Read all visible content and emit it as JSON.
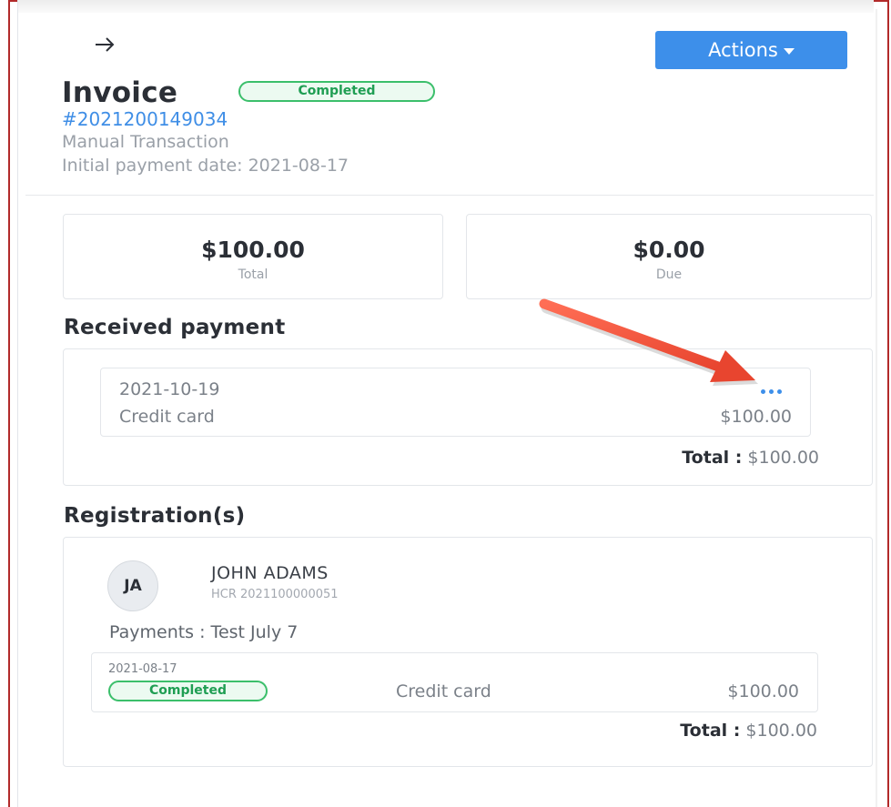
{
  "header": {
    "back_icon": "arrow-right-icon",
    "actions_label": "Actions",
    "title": "Invoice",
    "status_badge": "Completed",
    "invoice_number": "#2021200149034",
    "transaction_type": "Manual Transaction",
    "initial_payment_date": "Initial payment date: 2021-08-17"
  },
  "summary": [
    {
      "amount": "$100.00",
      "label": "Total"
    },
    {
      "amount": "$0.00",
      "label": "Due"
    }
  ],
  "received_payment": {
    "title": "Received payment",
    "items": [
      {
        "date": "2021-10-19",
        "method": "Credit card",
        "amount": "$100.00",
        "menu_icon": "more-horizontal-icon"
      }
    ],
    "total_label": "Total :",
    "total_value": "$100.00"
  },
  "registrations": {
    "title": "Registration(s)",
    "items": [
      {
        "initials": "JA",
        "name": "JOHN ADAMS",
        "code": "HCR 2021100000051",
        "payments_label": "Payments : Test July 7",
        "payment": {
          "date": "2021-08-17",
          "status": "Completed",
          "method": "Credit card",
          "amount": "$100.00"
        },
        "total_label": "Total :",
        "total_value": "$100.00"
      }
    ]
  },
  "colors": {
    "accent": "#3d8fea",
    "status_green": "#3bbf6b",
    "annotation_arrow": "#f0553c",
    "frame_border": "#b22a2a"
  }
}
